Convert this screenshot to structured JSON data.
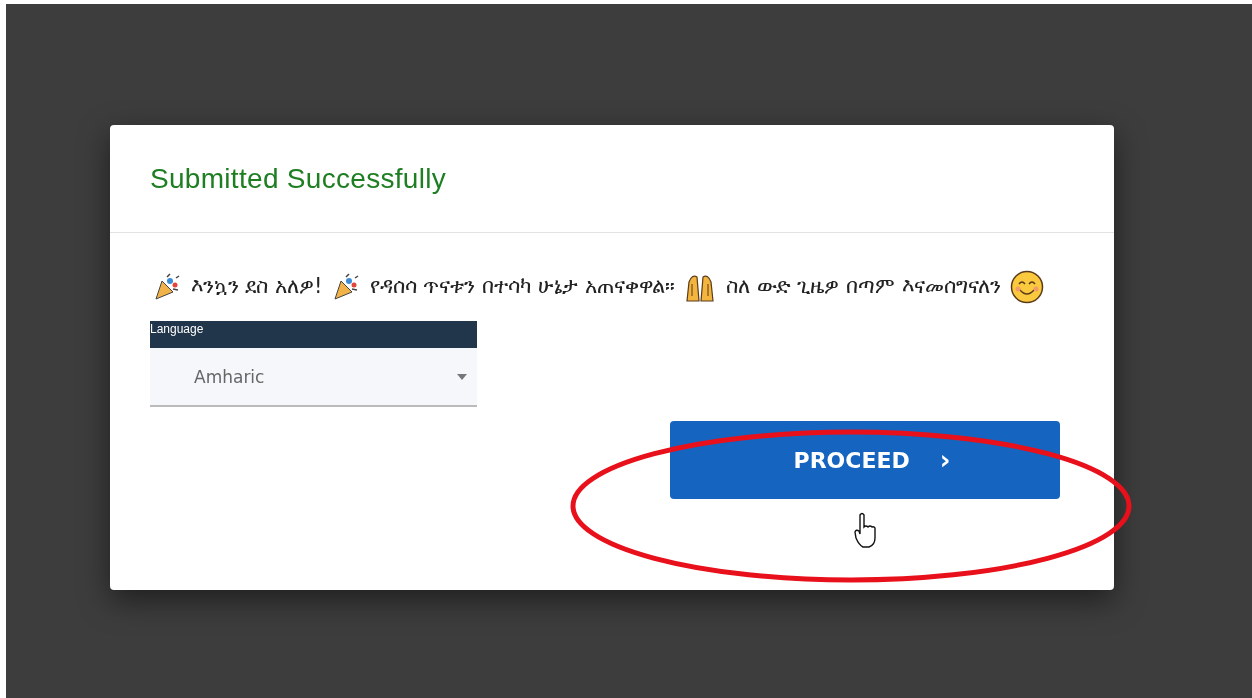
{
  "dialog": {
    "title": "Submitted Successfully",
    "message": [
      {
        "kind": "party"
      },
      {
        "kind": "text",
        "text": "እንኳን ደስ አለዎ!"
      },
      {
        "kind": "party"
      },
      {
        "kind": "text",
        "text": "የዳሰሳ ጥናቱን በተሳካ ሁኔታ አጠናቀዋል።"
      },
      {
        "kind": "hands"
      },
      {
        "kind": "text",
        "text": "ስለ ውድ ጊዜዎ በጣም እናመሰግናለን"
      },
      {
        "kind": "smile"
      }
    ],
    "language_select": {
      "label": "Language",
      "value": "Amharic"
    },
    "button": {
      "label": "PROCEED",
      "icon": "›"
    }
  },
  "annotation": {
    "kind": "ellipse",
    "color": "#e8101a"
  }
}
